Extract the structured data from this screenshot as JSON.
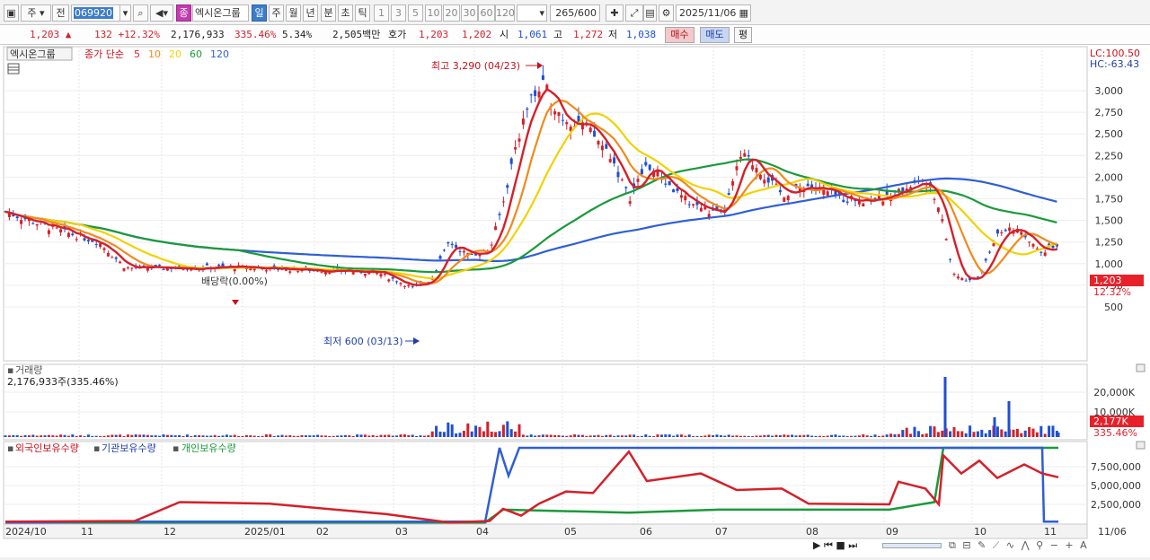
{
  "toolbar": {
    "period_type": "주",
    "prev_label": "전",
    "stock_code": "069920",
    "badge": "종",
    "stock_name": "엑시온그룹",
    "intervals": [
      "일",
      "주",
      "월",
      "년",
      "분",
      "초",
      "틱"
    ],
    "numbers": [
      "1",
      "3",
      "5",
      "10",
      "20",
      "30",
      "60",
      "120"
    ],
    "count": "265",
    "count_total": "/600",
    "date": "2025/11/06"
  },
  "quote": {
    "price": "1,203",
    "change": "132",
    "change_pct": "+12.32%",
    "volume": "2,176,933",
    "volume_ratio": "335.46%",
    "turnover": "5.34%",
    "amount": "2,505백만",
    "bid_label": "호가",
    "ask": "1,203",
    "bid": "1,202",
    "open_label": "시",
    "open": "1,061",
    "high_label": "고",
    "high": "1,272",
    "low_label": "저",
    "low": "1,038",
    "buy_label": "매수",
    "sell_label": "매도",
    "eval_label": "평"
  },
  "price_panel": {
    "name": "엑시온그룹",
    "ma_label": "종가 단순",
    "ma_periods": [
      "5",
      "10",
      "20",
      "60",
      "120"
    ],
    "ma_colors": [
      "#d4202a",
      "#f08a1c",
      "#f2d200",
      "#1a9a3a",
      "#2f5fd6"
    ],
    "lc_label": "LC:100.50",
    "hc_label": "HC:-63.43",
    "high_annotation": "최고 3,290 (04/23)",
    "low_annotation": "최저 600 (03/13)",
    "dividend_annotation": "배당락(0.00%)",
    "current_price_tag": "1,203",
    "current_pct_tag": "12.32%",
    "y_ticks": [
      "3,000",
      "2,750",
      "2,500",
      "2,250",
      "2,000",
      "1,750",
      "1,500",
      "1,250",
      "1,000",
      "750",
      "500"
    ]
  },
  "volume_panel": {
    "title": "거래량",
    "value_text": "2,176,933주(335.46%)",
    "y_ticks": [
      "20,000K",
      "10,000K"
    ],
    "current_tag": "2,177K",
    "current_pct": "335.46%"
  },
  "holding_panel": {
    "series": [
      "외국인보유수량",
      "기관보유수량",
      "개인보유수량"
    ],
    "y_ticks": [
      "7,500,000",
      "5,000,000",
      "2,500,000"
    ]
  },
  "x_axis": [
    "2024/10",
    "11",
    "12",
    "2025/01",
    "02",
    "03",
    "04",
    "05",
    "06",
    "07",
    "08",
    "09",
    "10",
    "11",
    "11/06"
  ],
  "colors": {
    "up": "#d4202a",
    "down": "#1f4fd1",
    "accent": "#3d7cc9"
  }
}
